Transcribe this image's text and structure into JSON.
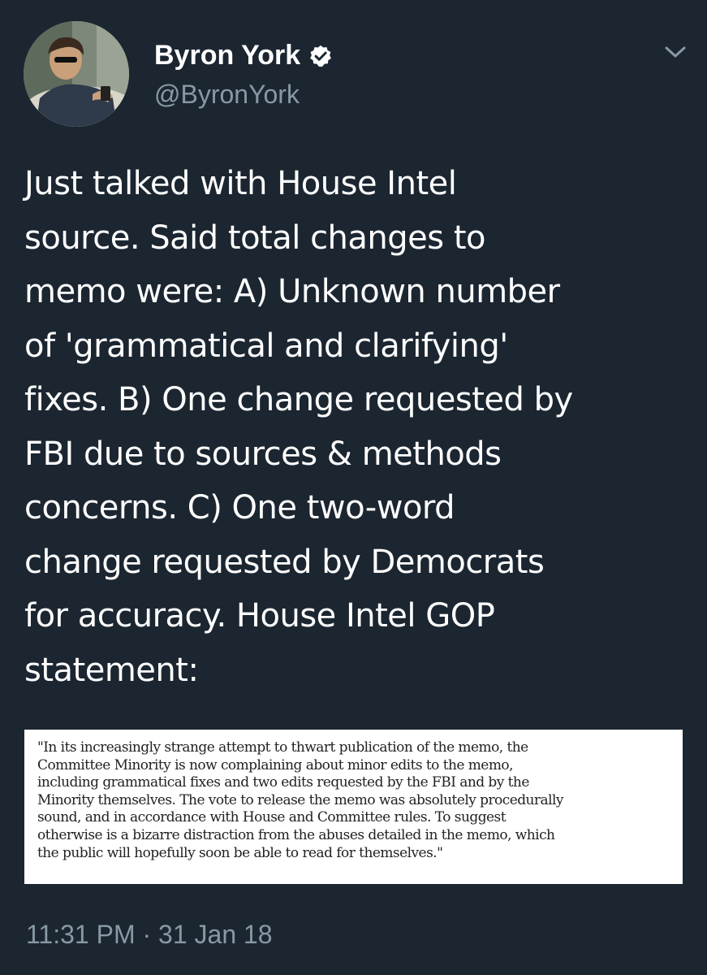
{
  "tweet": {
    "author": {
      "display_name": "Byron York",
      "handle": "@ByronYork",
      "verified": true
    },
    "text_lines": [
      "Just talked with House Intel",
      "source. Said total changes to",
      "memo were: A) Unknown number",
      "of 'grammatical and clarifying'",
      "fixes. B) One change requested by",
      "FBI due to sources & methods",
      "concerns. C) One two-word",
      "change requested by Democrats",
      "for accuracy. House Intel GOP",
      "statement:"
    ],
    "attached_image": {
      "lines": [
        "\"In its increasingly strange attempt to thwart publication of the memo, the",
        "Committee Minority is now complaining about minor edits to the memo,",
        "including grammatical fixes and two edits requested by the FBI and by the",
        "Minority themselves. The vote to release the memo was absolutely procedurally",
        "sound, and in accordance with House and Committee rules. To suggest",
        "otherwise is a bizarre distraction from the abuses detailed in the memo, which",
        "the public will hopefully soon be able to read for themselves.\""
      ]
    },
    "timestamp": "11:31 PM · 31 Jan 18"
  },
  "colors": {
    "background": "#1c2631",
    "text_primary": "#ffffff",
    "text_secondary": "#8899a6",
    "verified_badge": "#ffffff"
  },
  "icons": {
    "verified": "verified-badge-icon",
    "menu": "chevron-down-icon"
  }
}
